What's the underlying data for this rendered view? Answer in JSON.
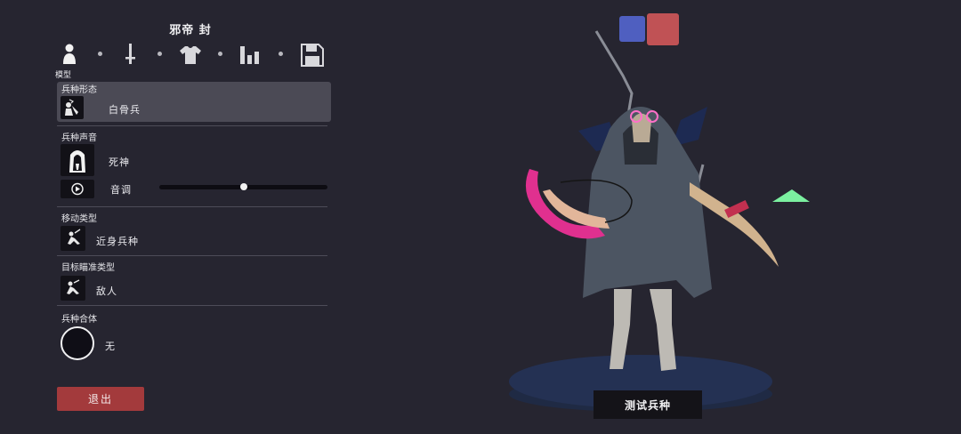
{
  "unit": {
    "name": "邪帝 封"
  },
  "tabs": [
    {
      "icon": "person-icon",
      "label": "模型",
      "active": true
    },
    {
      "icon": "sword-icon",
      "label": ""
    },
    {
      "icon": "shirt-icon",
      "label": ""
    },
    {
      "icon": "stats-icon",
      "label": ""
    },
    {
      "icon": "save-icon",
      "label": ""
    }
  ],
  "form": {
    "label": "兵种形态",
    "value": "白骨兵",
    "icon": "skeleton-icon"
  },
  "voice": {
    "label": "兵种声音",
    "value": "死神",
    "icon": "reaper-hood-icon",
    "pitch_label": "音调",
    "pitch_level": 0.5
  },
  "movement": {
    "label": "移动类型",
    "value": "近身兵种",
    "icon": "melee-icon"
  },
  "targeting": {
    "label": "目标瞄准类型",
    "value": "敌人",
    "icon": "target-enemy-icon"
  },
  "combine": {
    "label": "兵种合体",
    "value": "无"
  },
  "buttons": {
    "exit": "退出",
    "test": "测试兵种"
  },
  "colors": {
    "team_blue": "#4f5fc0",
    "team_red": "#c05255",
    "exit_button": "#a33a3c",
    "background": "#262530"
  }
}
